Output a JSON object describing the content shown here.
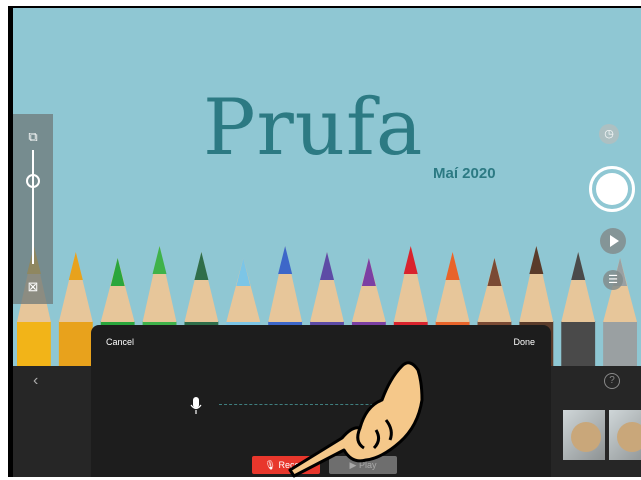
{
  "canvas": {
    "title": "Prufa",
    "subtitle": "Maí 2020"
  },
  "left_panel": {
    "top_icon": "layers-icon",
    "bottom_icon": "grid-off-icon",
    "slider_value": 0.75
  },
  "right_controls": {
    "timer_icon": "timer-icon",
    "shutter_icon": "shutter-icon",
    "play_icon": "play-icon",
    "list_icon": "list-icon"
  },
  "bottom_bar": {
    "back_icon": "chevron-left-icon",
    "help_label": "?"
  },
  "dialog": {
    "cancel_label": "Cancel",
    "done_label": "Done",
    "record_label": "Record",
    "play_label": "Play"
  },
  "colors": {
    "background": "#8fc7d3",
    "title": "#2c7a83",
    "record": "#e8372c",
    "dialog": "#1d1d1d"
  }
}
